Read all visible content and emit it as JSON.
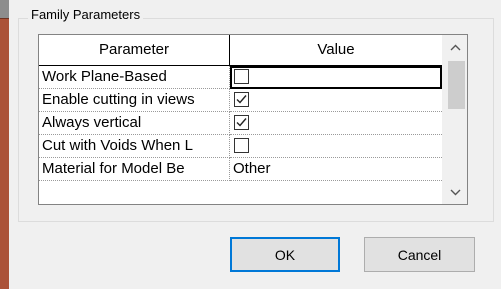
{
  "group": {
    "title": "Family Parameters"
  },
  "grid": {
    "columns": [
      "Parameter",
      "Value"
    ],
    "rows": [
      {
        "name": "Work Plane-Based",
        "type": "checkbox",
        "checked": false,
        "selected": true
      },
      {
        "name": "Enable cutting in views",
        "type": "checkbox",
        "checked": true
      },
      {
        "name": "Always vertical",
        "type": "checkbox",
        "checked": true
      },
      {
        "name": "Cut with Voids When L",
        "type": "checkbox",
        "checked": false
      },
      {
        "name": "Material for Model Be",
        "type": "text",
        "value": "Other"
      }
    ]
  },
  "buttons": {
    "ok": "OK",
    "cancel": "Cancel"
  }
}
